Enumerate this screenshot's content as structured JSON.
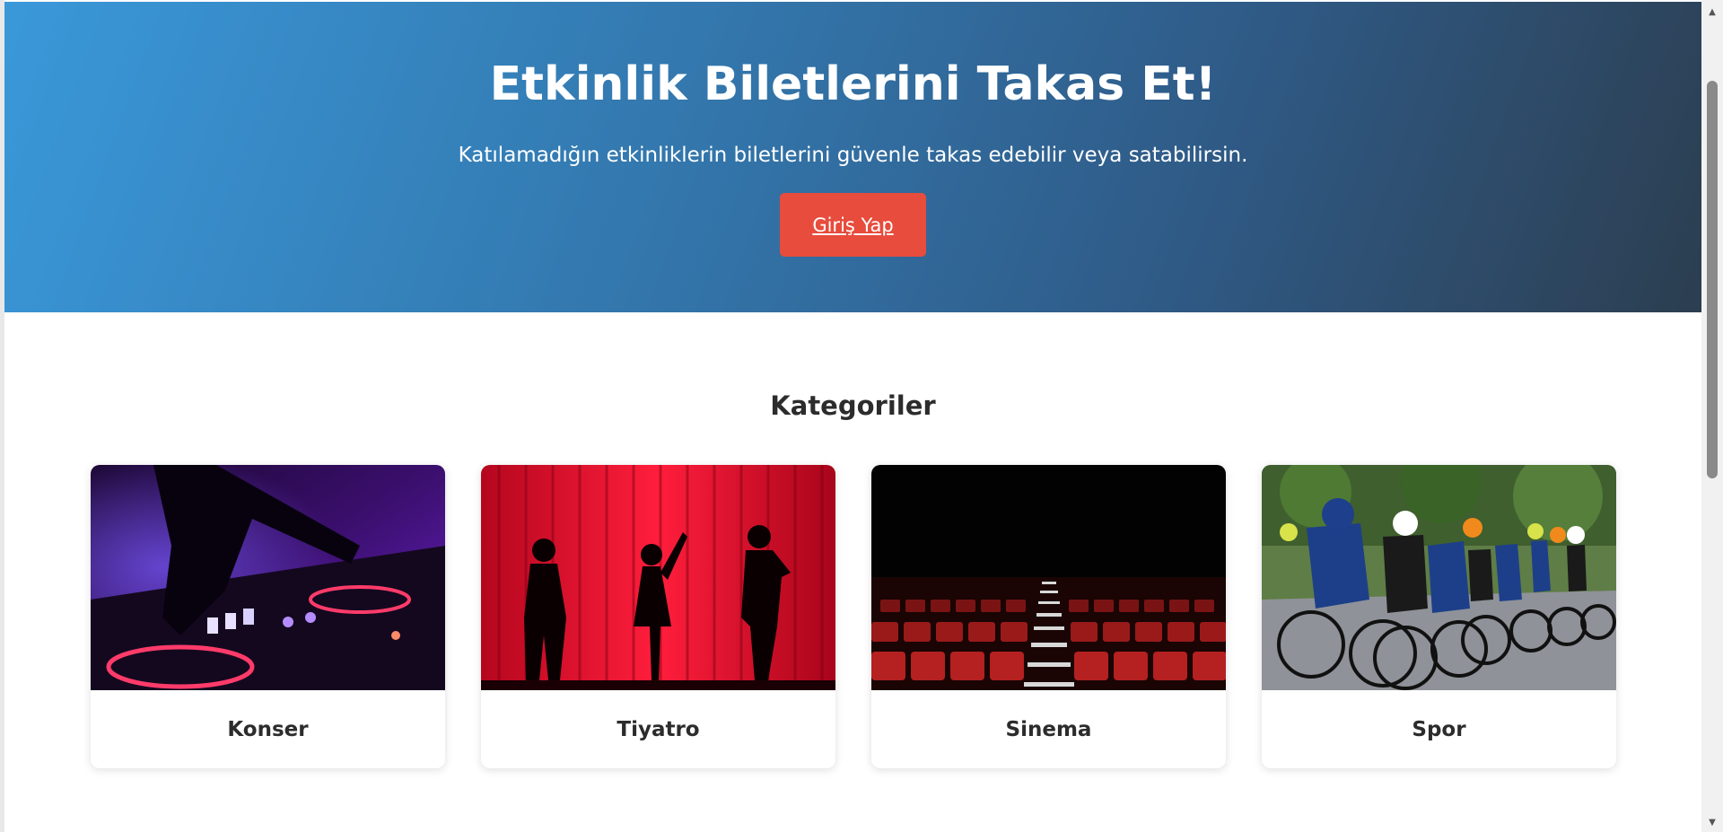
{
  "hero": {
    "title": "Etkinlik Biletlerini Takas Et!",
    "subtitle": "Katılamadığın etkinliklerin biletlerini güvenle takas edebilir veya satabilirsin.",
    "login_button": "Giriş Yap"
  },
  "categories": {
    "title": "Kategoriler",
    "items": [
      {
        "label": "Konser",
        "image": "dj-mixer-photo"
      },
      {
        "label": "Tiyatro",
        "image": "theatre-silhouettes-photo"
      },
      {
        "label": "Sinema",
        "image": "cinema-seats-photo"
      },
      {
        "label": "Spor",
        "image": "cyclists-race-photo"
      }
    ]
  },
  "colors": {
    "hero_gradient_start": "#3a98d9",
    "hero_gradient_end": "#2c3e50",
    "button": "#e74c3c",
    "text_dark": "#2c2c2c"
  },
  "scrollbar": {
    "up_icon": "scroll-up-arrow-icon",
    "down_icon": "scroll-down-arrow-icon"
  }
}
